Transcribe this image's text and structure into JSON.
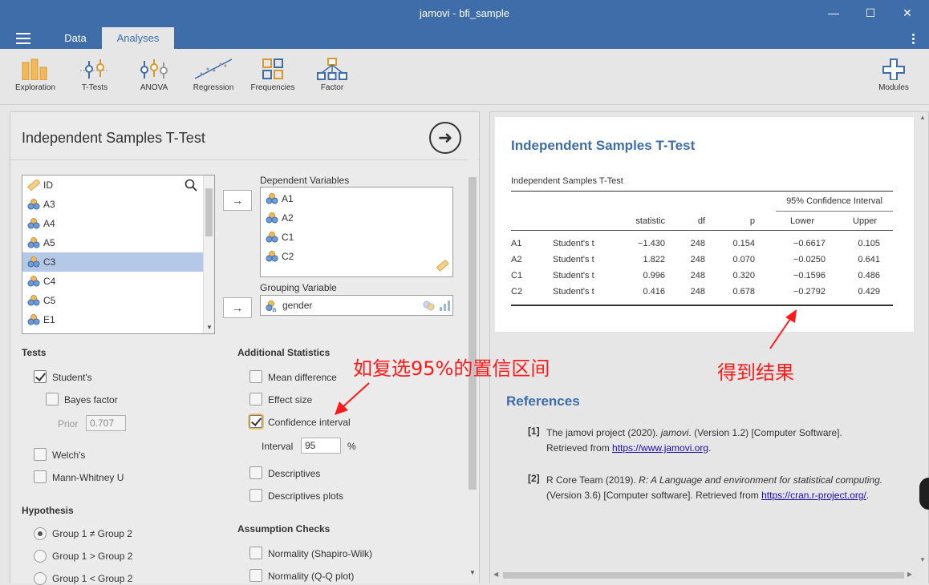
{
  "window": {
    "title": "jamovi - bfi_sample",
    "min": "—",
    "max": "☐",
    "close": "✕"
  },
  "tabs": [
    {
      "label": "Data"
    },
    {
      "label": "Analyses"
    }
  ],
  "ribbon": {
    "items": [
      {
        "label": "Exploration",
        "icon": "exploration-icon"
      },
      {
        "label": "T-Tests",
        "icon": "t-tests-icon"
      },
      {
        "label": "ANOVA",
        "icon": "anova-icon"
      },
      {
        "label": "Regression",
        "icon": "regression-icon"
      },
      {
        "label": "Frequencies",
        "icon": "frequencies-icon"
      },
      {
        "label": "Factor",
        "icon": "factor-icon"
      }
    ],
    "modules": "Modules"
  },
  "analysis": {
    "title": "Independent Samples T-Test",
    "variables": [
      "ID",
      "A3",
      "A4",
      "A5",
      "C3",
      "C4",
      "C5",
      "E1"
    ],
    "selected_variable": "C3",
    "dependent_label": "Dependent Variables",
    "dependent": [
      "A1",
      "A2",
      "C1",
      "C2"
    ],
    "grouping_label": "Grouping Variable",
    "grouping": "gender",
    "arrow": "→",
    "tests": {
      "head": "Tests",
      "students": "Student's",
      "bayes": "Bayes factor",
      "prior_label": "Prior",
      "prior_value": "0.707",
      "welch": "Welch's",
      "mann": "Mann-Whitney U"
    },
    "hypothesis": {
      "head": "Hypothesis",
      "opt1": "Group 1 ≠ Group 2",
      "opt2": "Group 1 > Group 2",
      "opt3": "Group 1 < Group 2"
    },
    "additional": {
      "head": "Additional Statistics",
      "mean_diff": "Mean difference",
      "effect": "Effect size",
      "ci": "Confidence interval",
      "interval_label": "Interval",
      "interval_value": "95",
      "pct": "%",
      "desc": "Descriptives",
      "desc_plots": "Descriptives plots"
    },
    "assumptions": {
      "head": "Assumption Checks",
      "normality": "Normality (Shapiro-Wilk)",
      "qq": "Normality (Q-Q plot)"
    }
  },
  "results": {
    "title": "Independent Samples T-Test",
    "table_caption": "Independent Samples T-Test",
    "ci_header": "95% Confidence Interval",
    "columns": [
      "statistic",
      "df",
      "p",
      "Lower",
      "Upper"
    ],
    "rows": [
      {
        "var": "A1",
        "test": "Student's t",
        "stat": "−1.430",
        "df": "248",
        "p": "0.154",
        "lower": "−0.6617",
        "upper": "0.105"
      },
      {
        "var": "A2",
        "test": "Student's t",
        "stat": "1.822",
        "df": "248",
        "p": "0.070",
        "lower": "−0.0250",
        "upper": "0.641"
      },
      {
        "var": "C1",
        "test": "Student's t",
        "stat": "0.996",
        "df": "248",
        "p": "0.320",
        "lower": "−0.1596",
        "upper": "0.486"
      },
      {
        "var": "C2",
        "test": "Student's t",
        "stat": "0.416",
        "df": "248",
        "p": "0.678",
        "lower": "−0.2792",
        "upper": "0.429"
      }
    ]
  },
  "references": {
    "head": "References",
    "r1_num": "[1]",
    "r1_a": "The jamovi project (2020). ",
    "r1_b": "jamovi",
    "r1_c": ". (Version 1.2) [Computer Software].",
    "r1_d": "Retrieved from ",
    "r1_link": "https://www.jamovi.org",
    "r2_num": "[2]",
    "r2_a": "R Core Team (2019). ",
    "r2_b": "R: A Language and environment for statistical computing.",
    "r2_c": "(Version 3.6) [Computer software]. Retrieved from ",
    "r2_link": "https://cran.r-project.org/",
    "dot": "."
  },
  "annotations": {
    "left": "如复选95%的置信区间",
    "right": "得到结果"
  },
  "colors": {
    "brand": "#3e6da9",
    "annotation": "#ff1a1a"
  }
}
